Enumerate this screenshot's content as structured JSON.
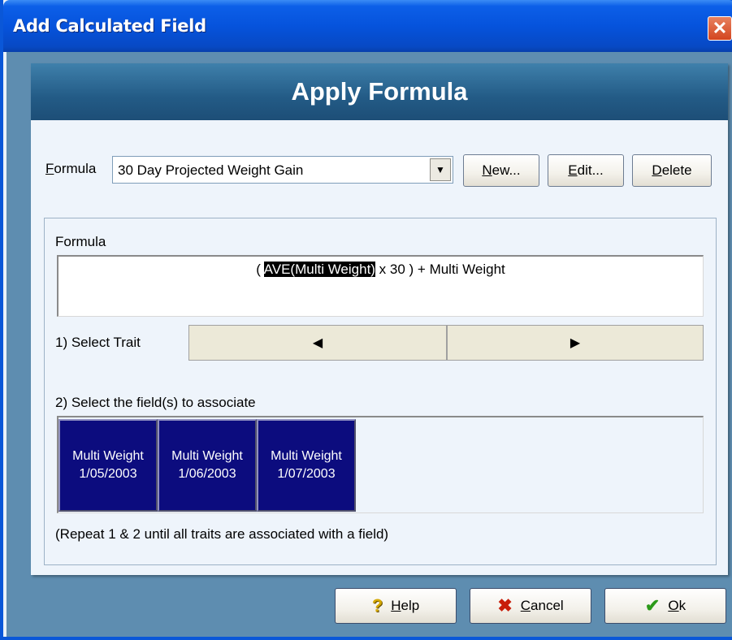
{
  "window": {
    "title": "Add Calculated Field",
    "close_glyph": "✕"
  },
  "banner": {
    "title": "Apply Formula"
  },
  "formula_selector": {
    "label_prefix": "",
    "label_mnemonic": "F",
    "label_rest": "ormula",
    "selected": "30 Day Projected Weight Gain",
    "dropdown_glyph": "▼"
  },
  "buttons": {
    "new": {
      "mnemonic": "N",
      "rest": "ew..."
    },
    "edit": {
      "mnemonic": "E",
      "rest": "dit..."
    },
    "delete": {
      "mnemonic": "D",
      "rest": "elete"
    }
  },
  "formula_section": {
    "label": "Formula",
    "expr_before": "( ",
    "expr_highlight": "AVE(Multi Weight)",
    "expr_after": " x 30 ) + Multi Weight"
  },
  "trait_selector": {
    "label": "1) Select Trait",
    "prev_glyph": "◀",
    "next_glyph": "▶"
  },
  "fields_section": {
    "label": "2) Select the field(s) to associate",
    "fields": [
      {
        "name": "Multi Weight",
        "date": "1/05/2003"
      },
      {
        "name": "Multi Weight",
        "date": "1/06/2003"
      },
      {
        "name": "Multi Weight",
        "date": "1/07/2003"
      }
    ],
    "hint": "(Repeat 1 & 2 until all traits are associated with a field)"
  },
  "footer": {
    "help": {
      "icon": "question-icon",
      "glyph": "?",
      "mnemonic": "H",
      "rest": "elp"
    },
    "cancel": {
      "icon": "x-icon",
      "glyph": "✖",
      "mnemonic": "C",
      "rest": "ancel"
    },
    "ok": {
      "icon": "check-icon",
      "glyph": "✔",
      "mnemonic": "O",
      "rest": "k"
    }
  },
  "colors": {
    "titlebar": "#0653dc",
    "banner": "#235b86",
    "dialog_bg": "#5e8db0",
    "field_tile": "#0c0c7e"
  }
}
